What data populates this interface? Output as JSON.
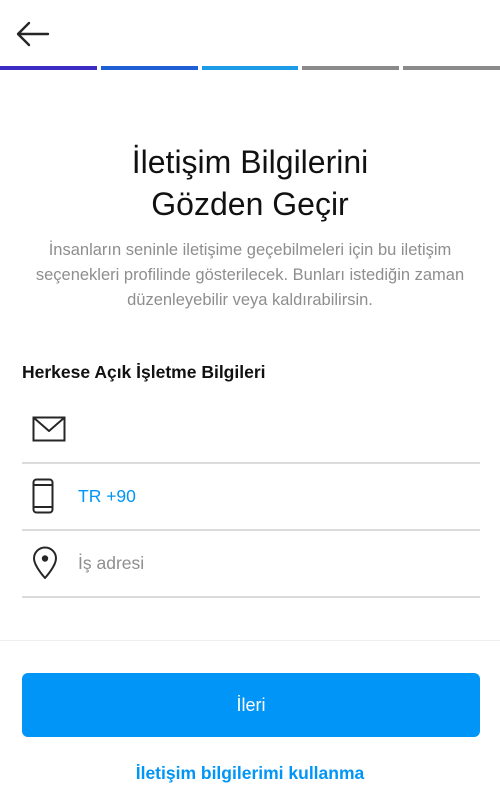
{
  "header": {
    "back_icon": "arrow-left-icon"
  },
  "progress": {
    "steps_total": 5,
    "steps_completed": 3,
    "colors": [
      "#3b2cc4",
      "#1f5fd6",
      "#1c9be6",
      "#8a8a8a",
      "#8a8a8a"
    ]
  },
  "main": {
    "title_line1": "İletişim Bilgilerini",
    "title_line2": "Gözden Geçir",
    "description": "İnsanların seninle iletişime geçebilmeleri için bu iletişim seçenekleri profilinde gösterilecek. Bunları istediğin zaman düzenleyebilir veya kaldırabilirsin.",
    "section_heading": "Herkese Açık İşletme Bilgileri"
  },
  "fields": {
    "email": {
      "icon": "envelope-icon",
      "value": ""
    },
    "phone": {
      "icon": "phone-icon",
      "value": "TR +90"
    },
    "address": {
      "icon": "location-pin-icon",
      "placeholder": "İş adresi"
    }
  },
  "actions": {
    "next_label": "İleri",
    "skip_label": "İletişim bilgilerimi kullanma"
  },
  "colors": {
    "accent": "#0095f6",
    "muted": "#8e8e8e",
    "divider": "#dbdbdb"
  }
}
